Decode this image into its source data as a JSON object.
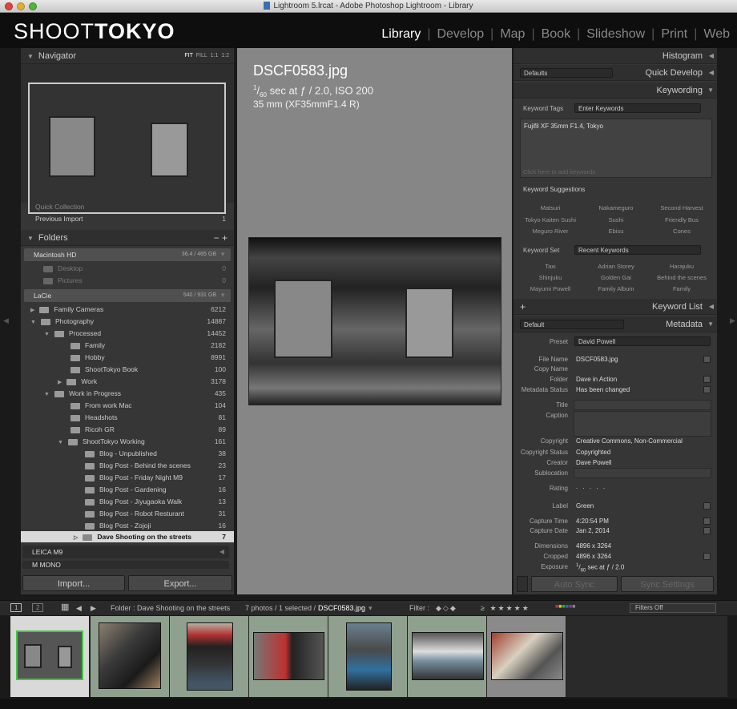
{
  "window": {
    "title": "Lightroom 5.lrcat - Adobe Photoshop Lightroom - Library"
  },
  "identity": {
    "brand_light": "SHOOT",
    "brand_bold": "TOKYO"
  },
  "modules": [
    "Library",
    "Develop",
    "Map",
    "Book",
    "Slideshow",
    "Print",
    "Web"
  ],
  "active_module": "Library",
  "navigator": {
    "title": "Navigator",
    "zoom": [
      "FIT",
      "FILL",
      "1:1",
      "1:2"
    ]
  },
  "catalog": {
    "quick_collection": "Quick Collection",
    "previous_import": "Previous Import",
    "previous_import_count": "1"
  },
  "folders": {
    "title": "Folders",
    "volumes": [
      {
        "name": "Macintosh HD",
        "size": "36.4 / 465 GB"
      },
      {
        "name": "LaCie",
        "size": "540 / 931 GB"
      },
      {
        "name": "LEICA M9"
      },
      {
        "name": "M MONO"
      }
    ],
    "mac_items": [
      {
        "name": "Desktop",
        "count": "0"
      },
      {
        "name": "Pictures",
        "count": "0"
      }
    ],
    "tree": [
      {
        "name": "Family Cameras",
        "count": "6212"
      },
      {
        "name": "Photography",
        "count": "14887"
      },
      {
        "name": "Processed",
        "count": "14452"
      },
      {
        "name": "Family",
        "count": "2182"
      },
      {
        "name": "Hobby",
        "count": "8991"
      },
      {
        "name": "ShootTokyo Book",
        "count": "100"
      },
      {
        "name": "Work",
        "count": "3178"
      },
      {
        "name": "Work in Progress",
        "count": "435"
      },
      {
        "name": "From work Mac",
        "count": "104"
      },
      {
        "name": "Headshots",
        "count": "81"
      },
      {
        "name": "Ricoh GR",
        "count": "89"
      },
      {
        "name": "ShootTokyo Working",
        "count": "161"
      },
      {
        "name": "Blog - Unpublished",
        "count": "38"
      },
      {
        "name": "Blog Post - Behind the scenes",
        "count": "23"
      },
      {
        "name": "Blog Post - Friday Night M9",
        "count": "17"
      },
      {
        "name": "Blog Post - Gardening",
        "count": "16"
      },
      {
        "name": "Blog Post - Jiyugaoka Walk",
        "count": "13"
      },
      {
        "name": "Blog Post - Robot Resturant",
        "count": "31"
      },
      {
        "name": "Blog Post - Zojoji",
        "count": "16"
      },
      {
        "name": "Dave Shooting on the streets",
        "count": "7"
      }
    ]
  },
  "buttons": {
    "import": "Import...",
    "export": "Export...",
    "auto_sync": "Auto Sync",
    "sync_settings": "Sync Settings"
  },
  "photo": {
    "filename": "DSCF0583.jpg",
    "exposure_num": "1",
    "exposure_den": "60",
    "exposure_rest": "sec at ƒ / 2.0, ISO 200",
    "lens_line": "35 mm (XF35mmF1.4 R)"
  },
  "right": {
    "histogram": "Histogram",
    "quick_develop": "Quick Develop",
    "qd_preset": "Defaults",
    "keywording": "Keywording",
    "keyword_tags_label": "Keyword Tags",
    "keyword_tags_select": "Enter Keywords",
    "keywords_text": "Fujifil XF 35mm F1.4, Tokyo",
    "click_to_add": "Click here to add keywords",
    "keyword_suggestions": "Keyword Suggestions",
    "suggestions": [
      "Matsuri",
      "Nakameguro",
      "Second Harvest",
      "Tokyo Kaiten Sushi",
      "Sushi",
      "Friendly Bus",
      "Meguro River",
      "Ebisu",
      "Cones"
    ],
    "keyword_set_label": "Keyword Set",
    "keyword_set_select": "Recent Keywords",
    "recent": [
      "Taxi",
      "Adrian Storey",
      "Harajuku",
      "Shinjuku",
      "Golden Gai",
      "Behind the scenes",
      "Mayumi Powell",
      "Family Album",
      "Family"
    ],
    "keyword_list": "Keyword List",
    "metadata": "Metadata",
    "metadata_preset_select": "Default",
    "preset_label": "Preset",
    "preset_value": "David Powell",
    "fields": {
      "file_name_label": "File Name",
      "file_name": "DSCF0583.jpg",
      "copy_name_label": "Copy Name",
      "folder_label": "Folder",
      "folder": "Dave in Action",
      "metadata_status_label": "Metadata Status",
      "metadata_status": "Has been changed",
      "title_label": "Title",
      "caption_label": "Caption",
      "copyright_label": "Copyright",
      "copyright": "Creative Commons, Non-Commercial",
      "copyright_status_label": "Copyright Status",
      "copyright_status": "Copyrighted",
      "creator_label": "Creator",
      "creator": "Dave Powell",
      "sublocation_label": "Sublocation",
      "rating_label": "Rating",
      "rating": ". . . . .",
      "label_label": "Label",
      "label": "Green",
      "capture_time_label": "Capture Time",
      "capture_time": "4:20:54 PM",
      "capture_date_label": "Capture Date",
      "capture_date": "Jan 2, 2014",
      "dimensions_label": "Dimensions",
      "dimensions": "4896 x 3264",
      "cropped_label": "Cropped",
      "cropped": "4896 x 3264",
      "exposure_label": "Exposure",
      "exposure": "sec at ƒ / 2.0"
    }
  },
  "filmbar": {
    "page1": "1",
    "page2": "2",
    "folder_text": "Folder : Dave Shooting on the streets",
    "count_text": "7 photos / 1 selected /",
    "selected_file": "DSCF0583.jpg",
    "filter_label": "Filter :",
    "filters_off": "Filters Off"
  },
  "colors": {
    "accent_green": "#8fa08f",
    "selection": "#d9d9d9",
    "panel": "#363636"
  }
}
